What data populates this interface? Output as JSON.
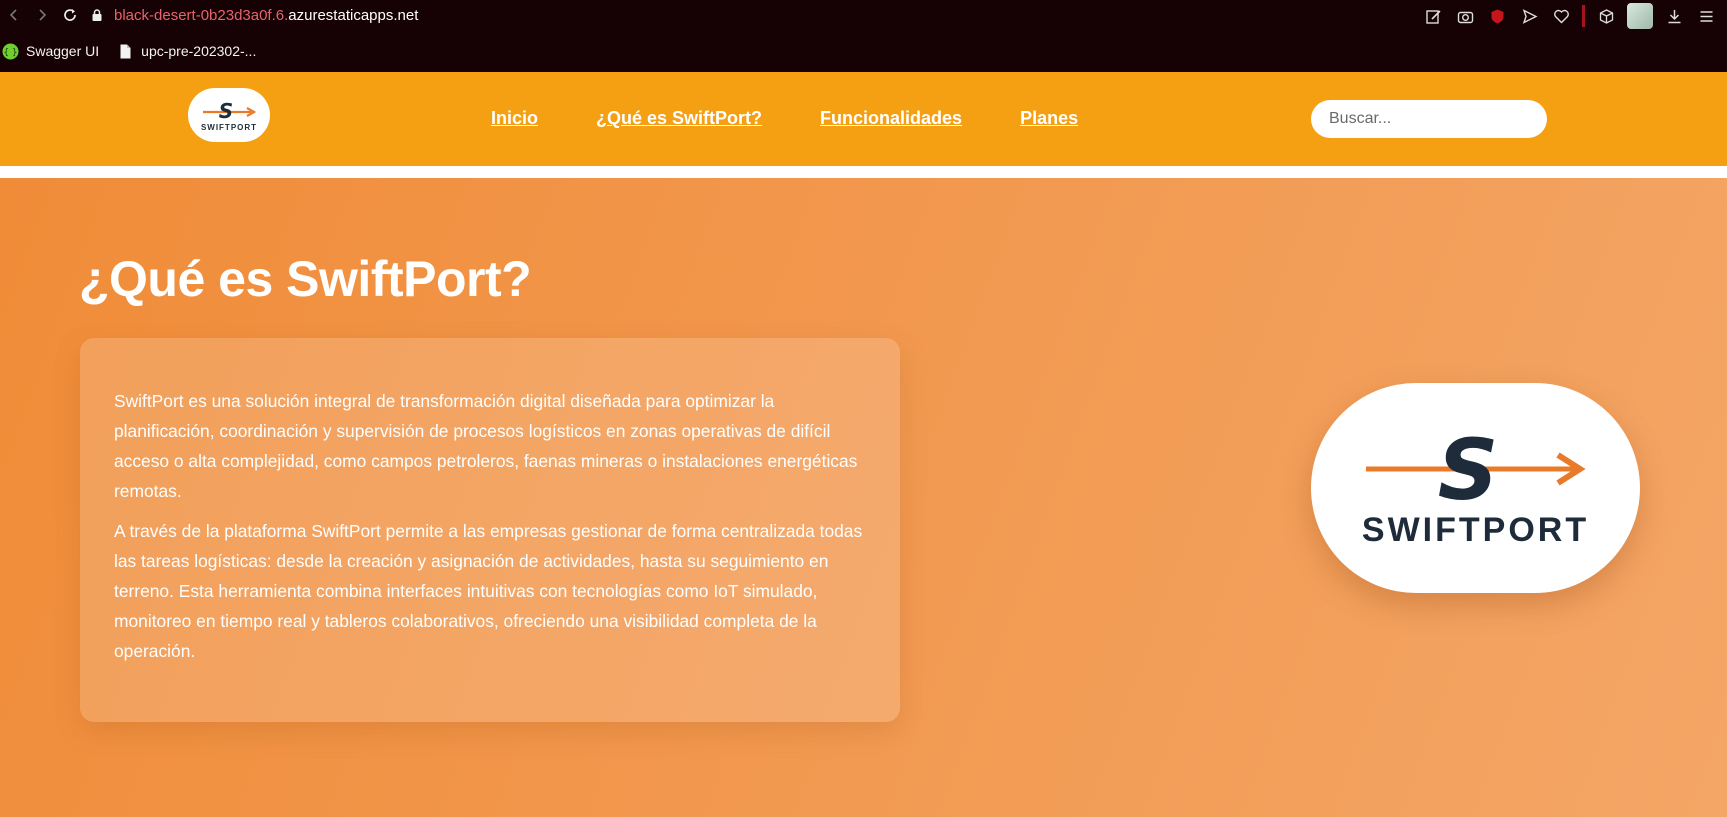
{
  "browser": {
    "url_subdomain": "black-desert-0b23d3a0f.6.",
    "url_domain": "azurestaticapps.net",
    "bookmarks": [
      {
        "label": "Swagger UI",
        "icon": "swagger-icon"
      },
      {
        "label": "upc-pre-202302-...",
        "icon": "file-icon"
      }
    ]
  },
  "header": {
    "logo_text": "SWIFTPORT",
    "nav": [
      {
        "label": "Inicio"
      },
      {
        "label": "¿Qué es SwiftPort?"
      },
      {
        "label": "Funcionalidades"
      },
      {
        "label": "Planes"
      }
    ],
    "search_placeholder": "Buscar..."
  },
  "hero": {
    "title": "¿Qué es SwiftPort?",
    "paragraphs": [
      "SwiftPort es una solución integral de transformación digital diseñada para optimizar la planificación, coordinación y supervisión de procesos logísticos en zonas operativas de difícil acceso o alta complejidad, como campos petroleros, faenas mineras o instalaciones energéticas remotas.",
      "A través de la plataforma SwiftPort permite a las empresas gestionar de forma centralizada todas las tareas logísticas: desde la creación y asignación de actividades, hasta su seguimiento en terreno. Esta herramienta combina interfaces intuitivas con tecnologías como IoT simulado, monitoreo en tiempo real y tableros colaborativos, ofreciendo una visibilidad completa de la operación."
    ],
    "logo_text": "SWIFTPORT"
  },
  "colors": {
    "header_bg": "#f4a012",
    "hero_bg": "#f29a52",
    "brand_orange": "#e87a2a",
    "brand_navy": "#1e2b3a"
  }
}
